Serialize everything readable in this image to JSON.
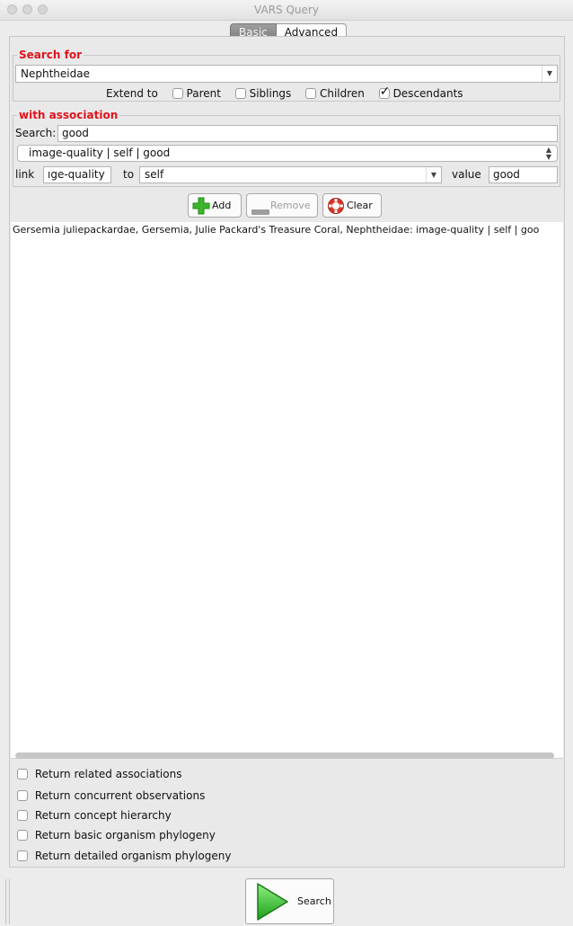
{
  "window": {
    "title": "VARS Query"
  },
  "tabs": [
    {
      "label": "Basic",
      "active": true
    },
    {
      "label": "Advanced",
      "active": false
    }
  ],
  "search_for": {
    "legend": "Search for",
    "concept_value": "Nephtheidae",
    "extend_label": "Extend to",
    "extend_options": [
      {
        "label": "Parent",
        "checked": false
      },
      {
        "label": "Siblings",
        "checked": false
      },
      {
        "label": "Children",
        "checked": false
      },
      {
        "label": "Descendants",
        "checked": true
      }
    ]
  },
  "association": {
    "legend": "with association",
    "search_label": "Search:",
    "search_value": "good",
    "selected_association": "image-quality | self | good",
    "link_label": "link",
    "link_value": "ıge-quality",
    "to_label": "to",
    "to_value": "self",
    "value_label": "value",
    "value_value": "good"
  },
  "buttons": {
    "add": "Add",
    "remove": "Remove",
    "clear": "Clear",
    "search": "Search"
  },
  "results": [
    "Gersemia juliepackardae, Gersemia, Julie Packard's Treasure Coral, Nephtheidae: image-quality | self | goo"
  ],
  "return_options": [
    {
      "label": "Return related associations",
      "checked": false
    },
    {
      "label": "Return concurrent observations",
      "checked": false
    },
    {
      "label": "Return concept hierarchy",
      "checked": false
    },
    {
      "label": "Return basic organism phylogeny",
      "checked": false
    },
    {
      "label": "Return detailed organism phylogeny",
      "checked": false
    }
  ],
  "colors": {
    "legend_red": "#e0131c",
    "add_green": "#3bb52b",
    "clear_red": "#d9362b",
    "search_green": "#2fc22f"
  },
  "icons": {
    "add": "plus-icon",
    "remove": "minus-icon",
    "clear": "lifebuoy-icon",
    "search": "play-icon"
  }
}
